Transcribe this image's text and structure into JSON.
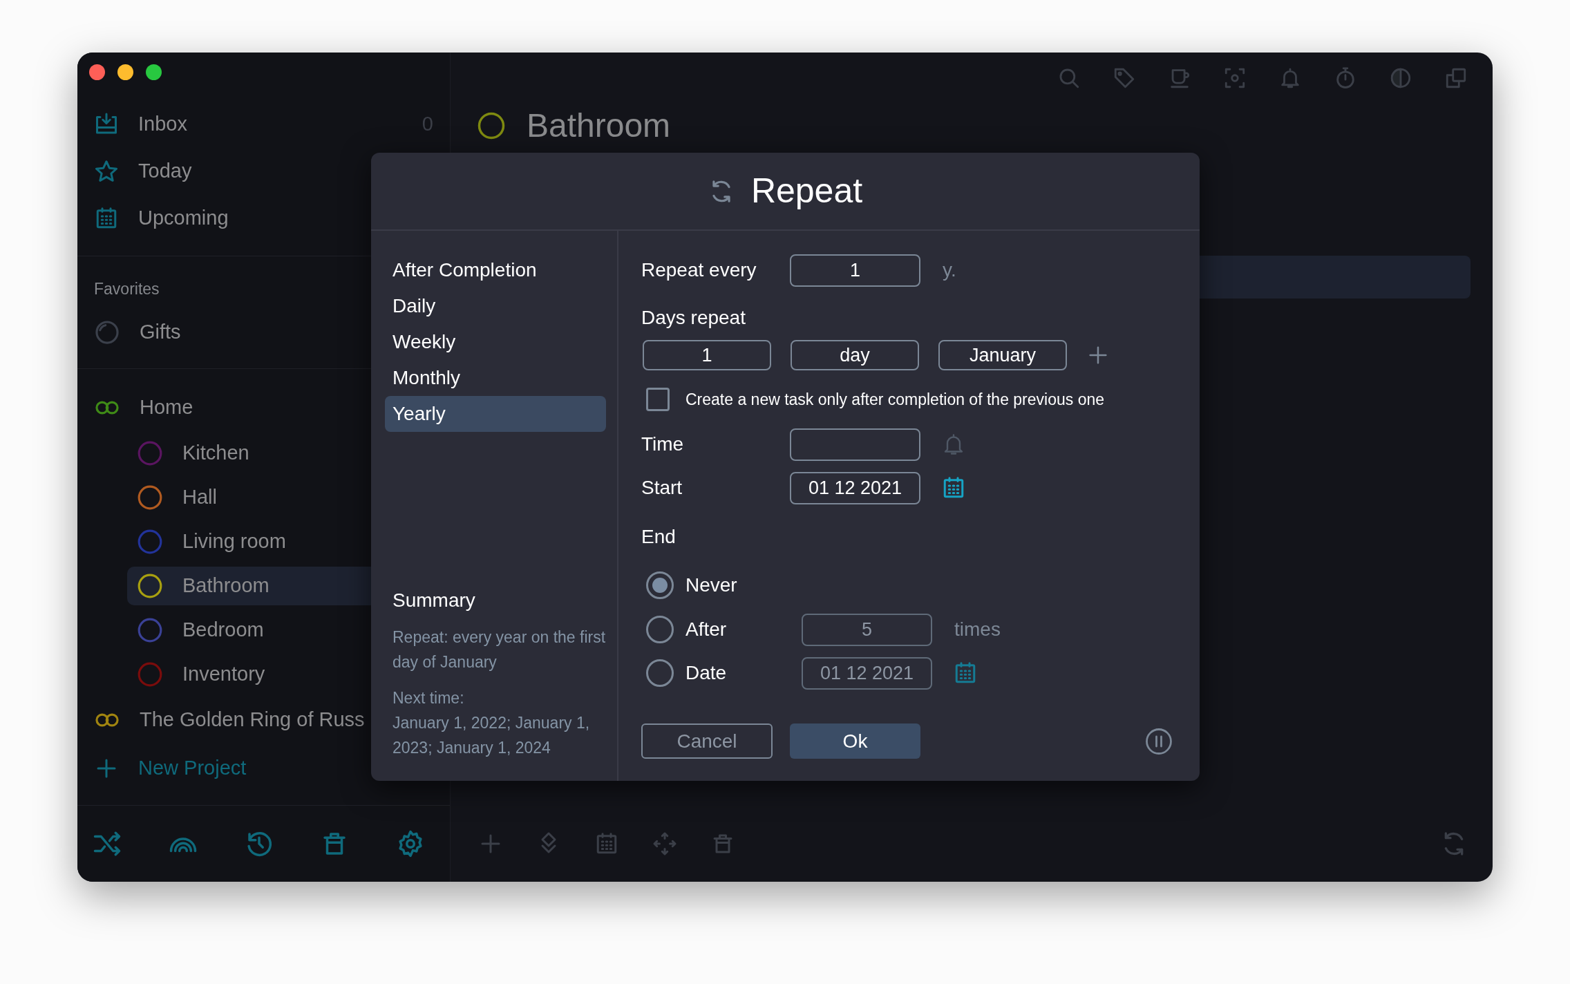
{
  "sidebar": {
    "nav": [
      {
        "label": "Inbox",
        "kind": "inbox",
        "count": "0"
      },
      {
        "label": "Today",
        "kind": "star"
      },
      {
        "label": "Upcoming",
        "kind": "calendar"
      }
    ],
    "favorites": {
      "title": "Favorites",
      "items": [
        {
          "label": "Gifts",
          "kind": "ring"
        }
      ]
    },
    "projects": [
      {
        "label": "Home",
        "color": "#3f8a17",
        "selected": false,
        "children": [
          {
            "label": "Kitchen",
            "color": "#5a1560",
            "selected": false
          },
          {
            "label": "Hall",
            "color": "#b05a20",
            "selected": false
          },
          {
            "label": "Living room",
            "color": "#22339a",
            "selected": false
          },
          {
            "label": "Bathroom",
            "color": "#a8a010",
            "selected": true
          },
          {
            "label": "Bedroom",
            "color": "#3a4196",
            "selected": false
          },
          {
            "label": "Inventory",
            "color": "#7a0c0c",
            "selected": false
          }
        ]
      },
      {
        "label": "The Golden Ring of Russ",
        "color": "#a08410",
        "selected": false
      }
    ],
    "new_project": "New Project"
  },
  "main": {
    "heading": "Bathroom"
  },
  "dialog": {
    "title": "Repeat",
    "modes": [
      {
        "label": "After Completion",
        "selected": false
      },
      {
        "label": "Daily",
        "selected": false
      },
      {
        "label": "Weekly",
        "selected": false
      },
      {
        "label": "Monthly",
        "selected": false
      },
      {
        "label": "Yearly",
        "selected": true
      }
    ],
    "summary": {
      "title": "Summary",
      "text": "Repeat: every year on the first day of January",
      "next_label": "Next time:",
      "next_text": "January 1, 2022; January 1, 2023; January 1, 2024"
    },
    "repeat_every": {
      "label": "Repeat every",
      "value": "1",
      "unit": "y."
    },
    "days_repeat": {
      "label": "Days repeat",
      "fields": [
        "1",
        "day",
        "January"
      ]
    },
    "only_after_completion": {
      "label": "Create a new task only after completion of the previous one",
      "checked": false
    },
    "time": {
      "label": "Time"
    },
    "start": {
      "label": "Start",
      "value": "01 12 2021"
    },
    "end": {
      "label": "End",
      "options": [
        {
          "label": "Never",
          "kind": "never",
          "selected": true
        },
        {
          "label": "After",
          "kind": "count",
          "value": "5",
          "unit": "times",
          "selected": false
        },
        {
          "label": "Date",
          "kind": "date",
          "value": "01 12 2021",
          "selected": false
        }
      ]
    },
    "buttons": {
      "cancel": "Cancel",
      "ok": "Ok"
    }
  }
}
